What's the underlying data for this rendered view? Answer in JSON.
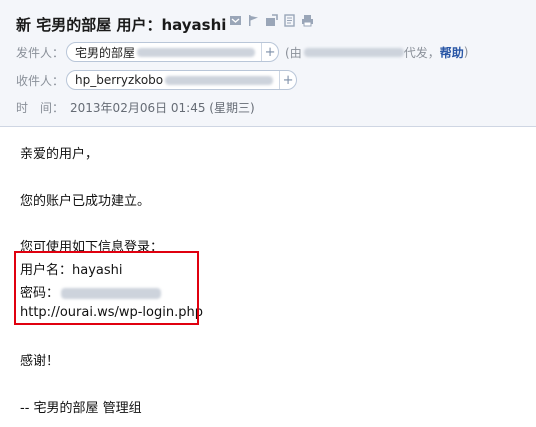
{
  "subject": "新 宅男的部屋 用户：hayashi",
  "toolbar": {
    "icons": [
      "mark-icon",
      "flag-icon",
      "move-icon",
      "note-icon",
      "print-icon"
    ]
  },
  "header": {
    "from_label": "发件人：",
    "from_name": "宅男的部屋",
    "via_prefix": "(由",
    "via_suffix": "代发，",
    "help": "帮助",
    "via_close": ")",
    "to_label": "收件人：",
    "to_name": "hp_berryzkobo",
    "time_label": "时　间：",
    "time_value": "2013年02月06日 01:45 (星期三)"
  },
  "body": {
    "greeting": "亲爱的用户，",
    "account_created": "您的账户已成功建立。",
    "login_intro": "您可使用如下信息登录：",
    "username_line": "用户名：hayashi",
    "password_label": "密码：",
    "login_url": "http://ourai.ws/wp-login.php",
    "thanks": "感谢！",
    "signature": "-- 宅男的部屋 管理组"
  },
  "colors": {
    "header_bg": "#f4f6fa",
    "highlight_box": "#e0000f",
    "help_link": "#2a57a6"
  }
}
